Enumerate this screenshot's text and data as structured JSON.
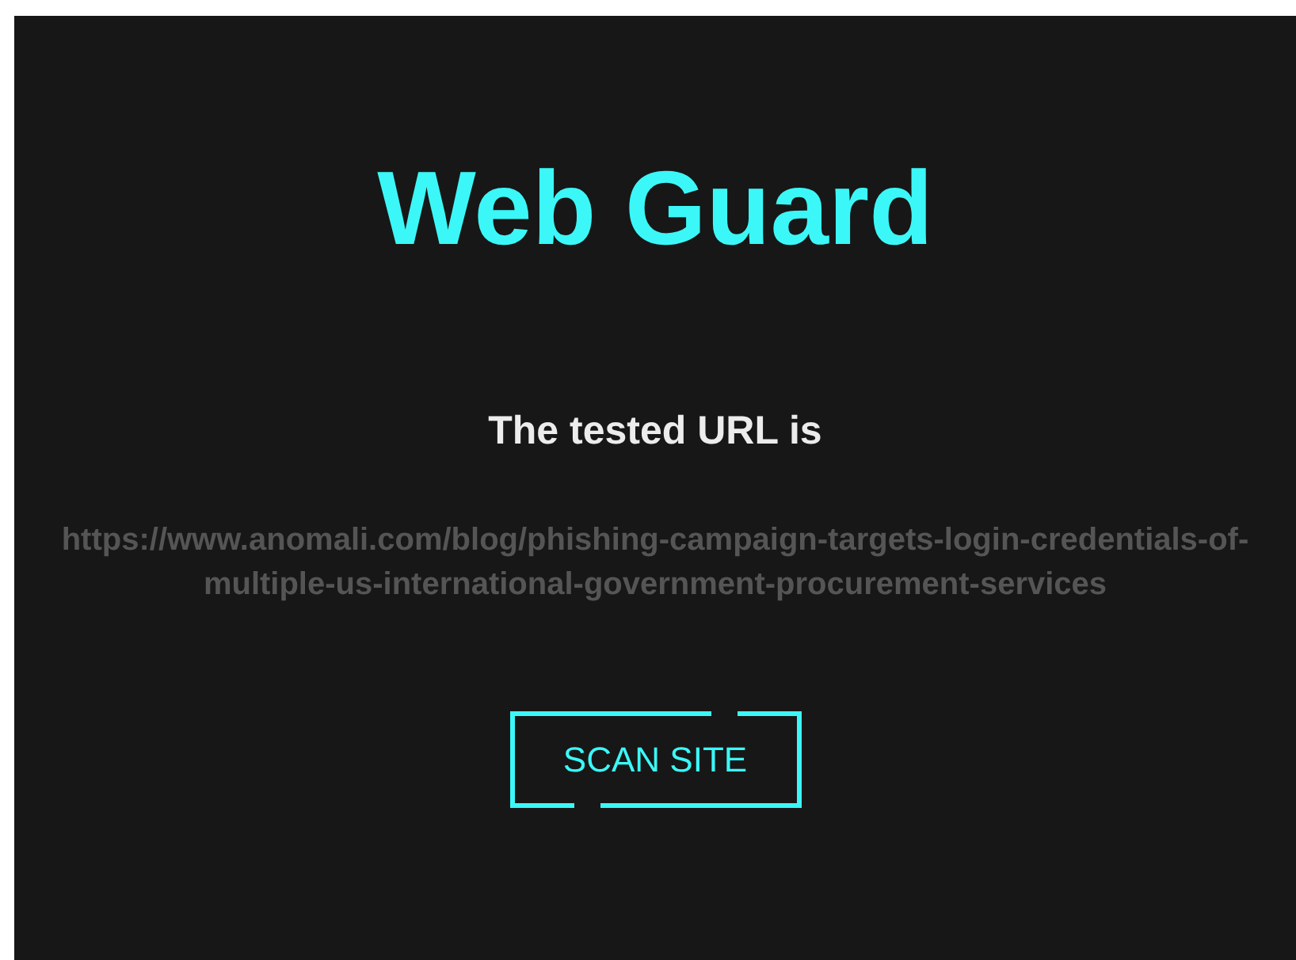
{
  "title": "Web Guard",
  "subtitle": "The tested URL is",
  "url": "https://www.anomali.com/blog/phishing-campaign-targets-login-credentials-of-multiple-us-international-government-procurement-services",
  "button": "SCAN SITE"
}
